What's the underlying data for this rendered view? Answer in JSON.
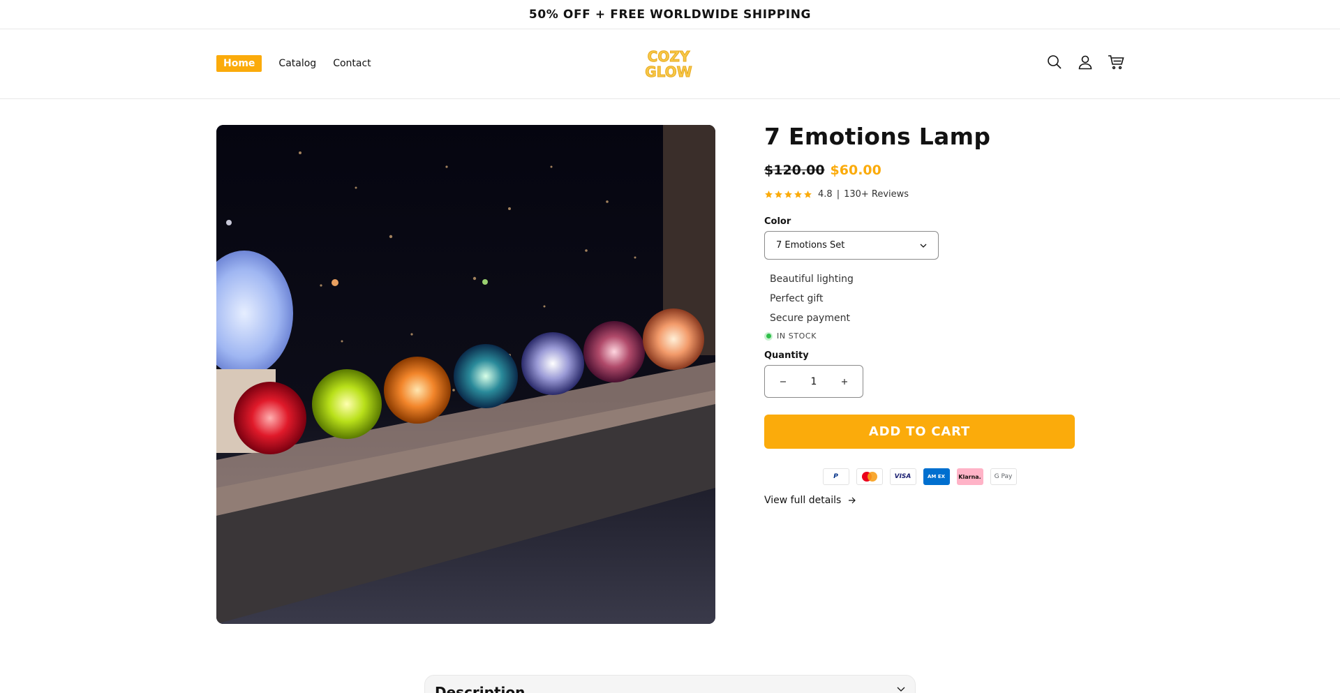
{
  "announcement": "50% OFF + FREE WORLDWIDE SHIPPING",
  "nav": {
    "home": "Home",
    "catalog": "Catalog",
    "contact": "Contact"
  },
  "logo": {
    "line1": "COZY",
    "line2": "GLOW"
  },
  "header_icons": [
    "search-icon",
    "account-icon",
    "cart-icon"
  ],
  "product": {
    "title": "7 Emotions Lamp",
    "price_old": "$120.00",
    "price_new": "$60.00",
    "rating_value": "4.8",
    "rating_separator": "|",
    "reviews": "130+ Reviews",
    "color_label": "Color",
    "color_selected": "7 Emotions Set",
    "features": [
      "Beautiful lighting",
      "Perfect gift",
      "Secure payment"
    ],
    "stock": "IN STOCK",
    "quantity_label": "Quantity",
    "quantity": "1",
    "add_to_cart": "ADD TO CART",
    "view_full": "View full details"
  },
  "payments": {
    "paypal": "P",
    "mastercard": "",
    "visa": "VISA",
    "amex": "AM EX",
    "klarna": "Klarna.",
    "gpay": "G Pay"
  },
  "description_label": "Description",
  "colors": {
    "accent": "#fbab0b",
    "text": "#121212",
    "stock_green": "#2fbf4a"
  }
}
